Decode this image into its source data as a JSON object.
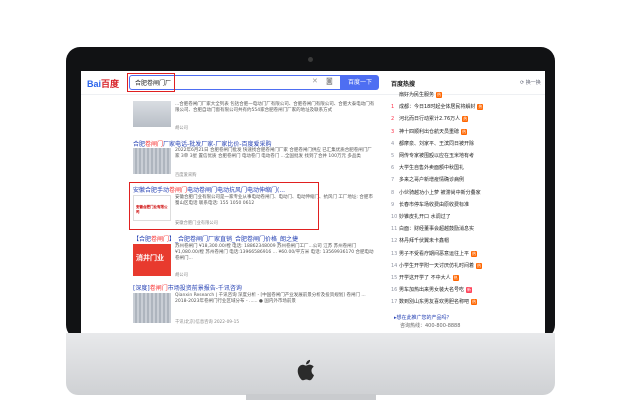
{
  "search": {
    "logo_text": "Bai",
    "logo_text2": "百度",
    "query": "合肥卷闸门厂",
    "button_label": "百度一下"
  },
  "results": [
    {
      "title_pre": "",
      "title_red": "",
      "title_post": "",
      "text": "...合肥卷闸门厂家大全列表 包括合肥一电动门厂有限公司、合肥卷闸门有限公司、合肥大泰电动门有限公司、合肥自动门窗有限公司共有约554家合肥卷闸门厂家的地址及联系方式",
      "source": "胡公司",
      "thumb": "door"
    },
    {
      "title_pre": "合肥",
      "title_red": "卷闸门",
      "title_post": "厂家电话-批发厂家-厂家比价-百度爱采购",
      "text": "2022年6月21日 合肥卷闸门批发 快速找合肥卷闸门厂家 合肥卷闸门供应 已汇集优质合肥卷闸门厂家 3单 3星 置信优质 合肥卷闸门 电动卷门 电动卷门 ...全国批发 找到了合并 100万元 多品类",
      "source": "百度爱采购",
      "thumb": "stripe"
    },
    {
      "title_pre": "安徽合肥手动",
      "title_red": "卷闸门",
      "title_post": "电动卷闸门电动抗风门电动伸缩门(...",
      "text": "安徽合肥门业有限公司是一家专业从事电动卷闸门、电动门、电动伸缩门、抗风门 工厂地址: 合肥市蜀山区电话 联系电话: 155 1050 0612",
      "source": "安徽合肥门业有限公司",
      "thumb": "logo",
      "logo_text": "安徽合肥门业有限公司"
    },
    {
      "title_pre": "【合肥",
      "title_red": "卷闸门",
      "title_post": "】_合肥卷闸门厂家直销_合肥卷闸门价格_朗之捷",
      "text": "苏州卷闸门 ¥18,300.00/樘 电话: 18862348009 苏州卷闸门工厂...公司 江苏 苏州卷闸门 ¥1,080.00/樘 苏州卷闸门 电话:13966586916 ... ¥60.00/平方米 电话: 13569936170 合肥电动卷闸门...",
      "source": "胡公司",
      "thumb": "red",
      "thumb_text": "消井门业"
    },
    {
      "title_pre": "[深度]",
      "title_red": "卷闸门",
      "title_post": "市场投资前景报告-千讯咨询",
      "text": "Qianxin Research | 千讯咨询 深度分析 - [中国卷闸门产业发展前景分析及投资规划] 卷闸门 ... 2018-2023年卷闸门行业区域分布 - ...... ● 国内外市场前景",
      "source": "千讯(北京)信息咨询 2022-09-15",
      "thumb": "door2"
    }
  ],
  "hot": {
    "title": "百度热搜",
    "refresh_label": "换一换",
    "items": [
      {
        "num": "",
        "text": "扇好为民生服务",
        "tag": "热"
      },
      {
        "num": "1",
        "text": "成都：今日18时起全体居民将解封",
        "tag": "热"
      },
      {
        "num": "2",
        "text": "河北而日行动累计2.76万人",
        "tag": "热"
      },
      {
        "num": "3",
        "text": "神十四顺利出仓航天员重磅",
        "tag": "热"
      },
      {
        "num": "4",
        "text": "都摩泉、刘家平、王滨同日被开除",
        "tag": ""
      },
      {
        "num": "5",
        "text": "网传专家被围殴以应在玉米地有考",
        "tag": ""
      },
      {
        "num": "6",
        "text": "大学生自售外卖面额中秋国礼",
        "tag": ""
      },
      {
        "num": "7",
        "text": "多来之哥户新增疫情确诊病例",
        "tag": ""
      },
      {
        "num": "8",
        "text": "小伙骑越功小上萝 被滞尚中新分叠家",
        "tag": ""
      },
      {
        "num": "9",
        "text": "长春市停车场收费由原收费标准",
        "tag": ""
      },
      {
        "num": "10",
        "text": "妙锥皮扎开口 水调过了",
        "tag": ""
      },
      {
        "num": "11",
        "text": "白面：财经董事会超越鼓励消息实",
        "tag": ""
      },
      {
        "num": "12",
        "text": "林丹拜千伏翼未卡鑫帽",
        "tag": ""
      },
      {
        "num": "13",
        "text": "男子不受看疗期间恶意运往上平",
        "tag": "热"
      },
      {
        "num": "14",
        "text": "小学生开学附一天讨厌仿礼时间着",
        "tag": "热"
      },
      {
        "num": "15",
        "text": "开学这开学了 不中大人",
        "tag": "热"
      },
      {
        "num": "16",
        "text": "男车加热出来男女装大名号吃",
        "tag": "新"
      },
      {
        "num": "17",
        "text": "数到別山东男友喜欢男胆名称吧",
        "tag": "热"
      }
    ]
  },
  "ad": {
    "link": "▸想在此推广您的产品吗？",
    "phone": "咨询热线：400-800-8888"
  },
  "colors": {
    "accent": "#4e6ef2",
    "highlight": "#e02020",
    "link": "#2440b3",
    "red_text": "#f73131"
  }
}
